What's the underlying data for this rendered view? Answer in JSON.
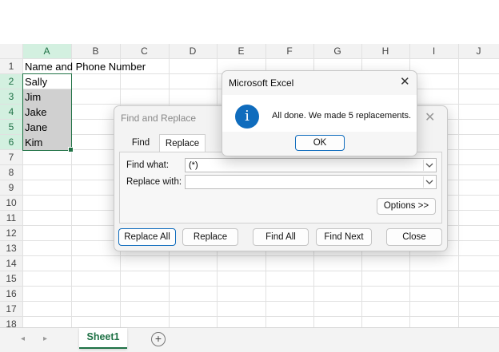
{
  "sheet": {
    "columns": [
      "A",
      "B",
      "C",
      "D",
      "E",
      "F",
      "G",
      "H",
      "I",
      "J"
    ],
    "rows": [
      "1",
      "2",
      "3",
      "4",
      "5",
      "6",
      "7",
      "8",
      "9",
      "10",
      "11",
      "12",
      "13",
      "14",
      "15",
      "16",
      "17",
      "18"
    ],
    "cells": {
      "a1": "Name and Phone Number",
      "a2": "Sally",
      "a3": "Jim",
      "a4": "Jake",
      "a5": "Jane",
      "a6": "Kim"
    }
  },
  "tabs": {
    "sheet1": "Sheet1",
    "add": "+"
  },
  "find_replace": {
    "title": "Find and Replace",
    "tab_find": "Find",
    "tab_replace": "Replace",
    "find_label": "Find what:",
    "replace_label": "Replace with:",
    "find_value": "(*)",
    "replace_value": "",
    "options_label": "Options >>",
    "replace_all_label": "Replace All",
    "replace_label_btn": "Replace",
    "find_all_label": "Find All",
    "find_next_label": "Find Next",
    "close_label": "Close"
  },
  "msgbox": {
    "title": "Microsoft Excel",
    "message": "All done. We made 5 replacements.",
    "ok_label": "OK",
    "info_glyph": "i"
  },
  "colors": {
    "accent": "#1e7145",
    "info": "#0f6cbd",
    "selection": "#217346"
  }
}
